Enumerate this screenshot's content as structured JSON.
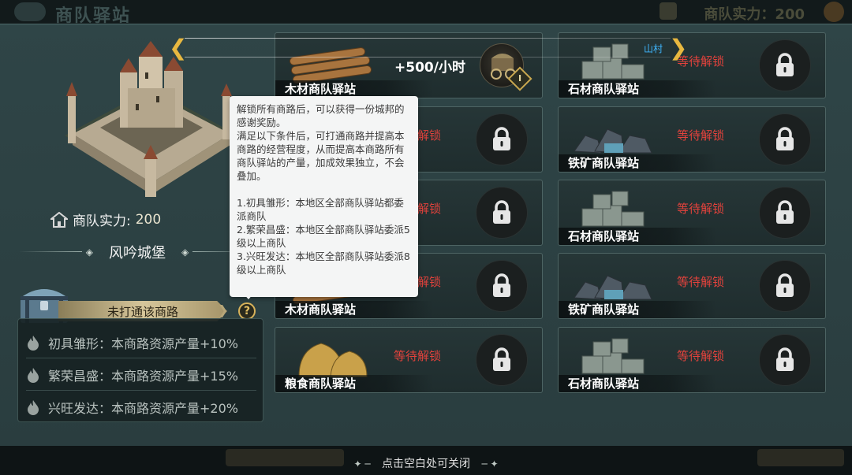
{
  "topbar": {
    "title": "商队驿站",
    "power_label": "商队实力：200"
  },
  "left": {
    "power_label": "商队实力:",
    "power_value": "200",
    "castle_name": "风吟城堡",
    "route_status": "未打通该商路",
    "help_symbol": "?",
    "bonuses": [
      "初具雏形：本商路资源产量+10%",
      "繁荣昌盛：本商路资源产量+15%",
      "兴旺发达：本商路资源产量+20%"
    ]
  },
  "tooltip": {
    "text": "解锁所有商路后，可以获得一份城邦的感谢奖励。\n满足以下条件后，可打通商路并提高本商路的经营程度，从而提高本商路所有商队驿站的产量，加成效果独立，不会叠加。\n\n1.初具雏形：本地区全部商队驿站都委派商队\n2.繁荣昌盛：本地区全部商队驿站委派5级以上商队\n3.兴旺发达：本地区全部商队驿站委派8级以上商队"
  },
  "banner": {
    "rate": "+500/小时",
    "location": "山村",
    "level": "I"
  },
  "stations": [
    {
      "name": "木材商队驿站",
      "status": "",
      "type": "wood",
      "locked": false
    },
    {
      "name": "石材商队驿站",
      "status": "等待解锁",
      "type": "stone",
      "locked": true
    },
    {
      "name": "",
      "status": "等待解锁",
      "type": "hidden",
      "locked": true
    },
    {
      "name": "铁矿商队驿站",
      "status": "等待解锁",
      "type": "iron",
      "locked": true
    },
    {
      "name": "",
      "status": "等待解锁",
      "type": "hidden",
      "locked": true
    },
    {
      "name": "石材商队驿站",
      "status": "等待解锁",
      "type": "stone",
      "locked": true
    },
    {
      "name": "木材商队驿站",
      "status": "等待解锁",
      "type": "wood",
      "locked": true
    },
    {
      "name": "铁矿商队驿站",
      "status": "等待解锁",
      "type": "iron",
      "locked": true
    },
    {
      "name": "粮食商队驿站",
      "status": "等待解锁",
      "type": "food",
      "locked": true
    },
    {
      "name": "石材商队驿站",
      "status": "等待解锁",
      "type": "stone",
      "locked": true
    }
  ],
  "footer": {
    "close_hint": "点击空白处可关闭"
  },
  "colors": {
    "status_red": "#e2423c",
    "gold": "#e8b840",
    "location_blue": "#3fb7ff"
  }
}
